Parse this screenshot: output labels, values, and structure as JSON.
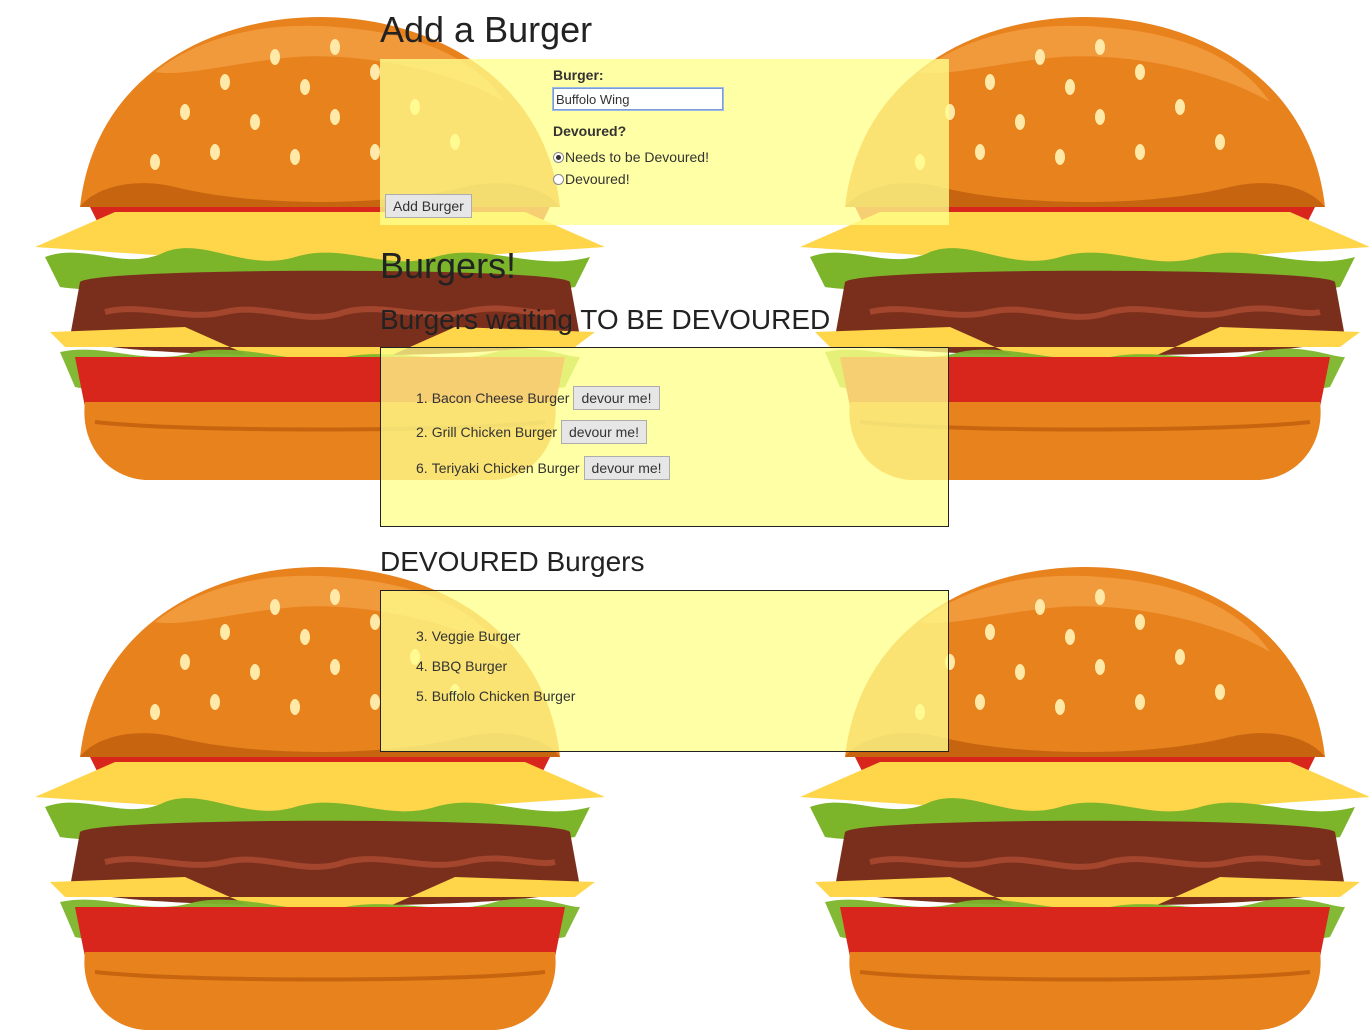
{
  "add_form": {
    "title": "Add a Burger",
    "burger_label": "Burger:",
    "burger_value": "Buffolo Wing",
    "devoured_label": "Devoured?",
    "radio_options": [
      "Needs to be Devoured!",
      "Devoured!"
    ],
    "selected_radio": "Needs to be Devoured!",
    "submit_label": "Add Burger"
  },
  "burgers_heading": "Burgers!",
  "waiting": {
    "heading": "Burgers waiting TO BE DEVOURED",
    "button_label": "devour me!",
    "items": [
      {
        "num": "1.",
        "name": "Bacon Cheese Burger"
      },
      {
        "num": "2.",
        "name": "Grill Chicken Burger"
      },
      {
        "num": "6.",
        "name": "Teriyaki Chicken Burger"
      }
    ]
  },
  "devoured": {
    "heading": "DEVOURED Burgers",
    "items": [
      {
        "num": "3.",
        "name": "Veggie Burger"
      },
      {
        "num": "4.",
        "name": "BBQ Burger"
      },
      {
        "num": "5.",
        "name": "Buffolo Chicken Burger"
      }
    ]
  },
  "colors": {
    "panel": "#ffff8c",
    "bun": "#e8821d",
    "lettuce": "#7cb52a",
    "tomato": "#d9261c",
    "cheese": "#ffd54a",
    "patty": "#7a2f1c"
  }
}
